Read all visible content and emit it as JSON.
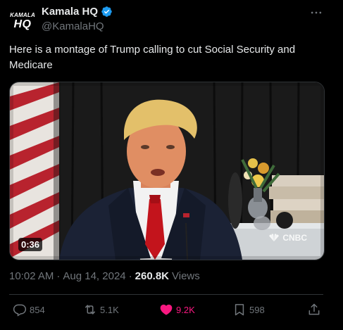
{
  "author": {
    "display_name": "Kamala HQ",
    "handle": "@KamalaHQ",
    "avatar_line1": "KAMALA",
    "avatar_line2": "HQ"
  },
  "tweet": {
    "text": "Here is a montage of Trump calling to cut Social Security and Medicare"
  },
  "media": {
    "duration": "0:36",
    "watermark": "CNBC"
  },
  "meta": {
    "time": "10:02 AM",
    "date": "Aug 14, 2024",
    "views_count": "260.8K",
    "views_label": "Views"
  },
  "actions": {
    "replies": "854",
    "reposts": "5.1K",
    "likes": "9.2K",
    "bookmarks": "598"
  },
  "colors": {
    "background": "#000000",
    "text_primary": "#e7e9ea",
    "text_secondary": "#71767b",
    "verified": "#1d9bf0",
    "like": "#f91880",
    "divider": "#2f3336"
  },
  "icons": {
    "verified": "verified-badge-icon",
    "more": "more-horizontal-icon",
    "reply": "reply-icon",
    "repost": "repost-icon",
    "like": "heart-filled-icon",
    "bookmark": "bookmark-icon",
    "share": "share-icon"
  }
}
